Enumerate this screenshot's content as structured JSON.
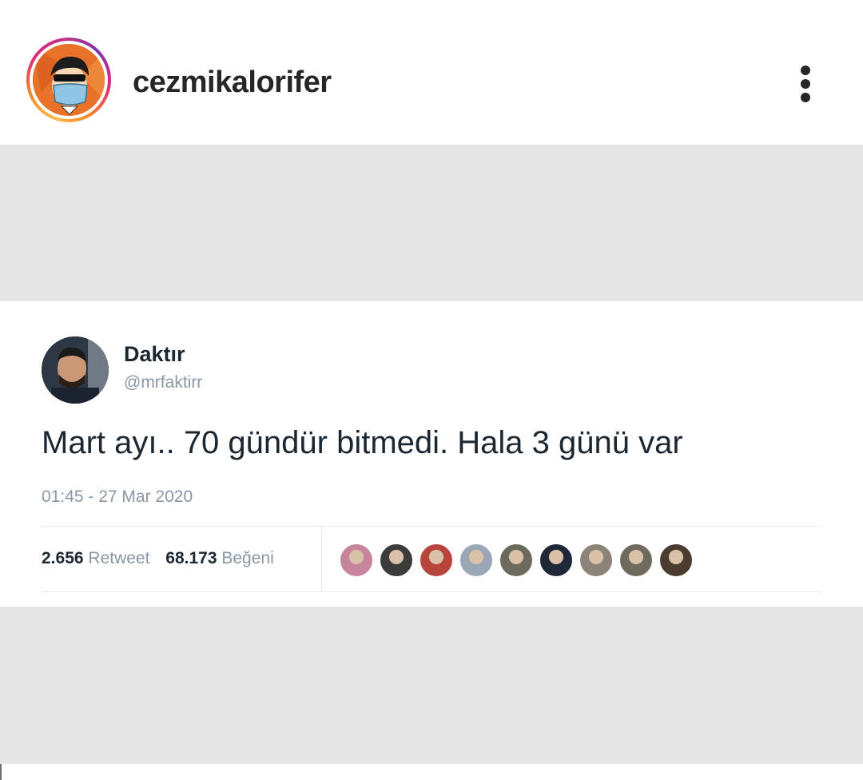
{
  "header": {
    "username": "cezmikalorifer",
    "avatar_icon": "profile-avatar",
    "more_icon": "more-options-icon"
  },
  "tweet": {
    "name": "Daktır",
    "handle": "@mrfaktirr",
    "text": "Mart ayı.. 70 gündür bitmedi. Hala 3 günü var",
    "timestamp": "01:45 - 27 Mar 2020",
    "retweet_count": "2.656",
    "retweet_label": "Retweet",
    "like_count": "68.173",
    "like_label": "Beğeni",
    "liker_colors": [
      "#c7849d",
      "#3b3b3b",
      "#b8453c",
      "#9aa7b4",
      "#6c6a5c",
      "#1e2836",
      "#8c8478",
      "#6f6a5e",
      "#4a3d30"
    ]
  },
  "colors": {
    "background": "#ffffff",
    "post_background": "#e6e6e6",
    "text_primary": "#262626",
    "tweet_text": "#1c2732",
    "tweet_secondary": "#8a97a3"
  }
}
